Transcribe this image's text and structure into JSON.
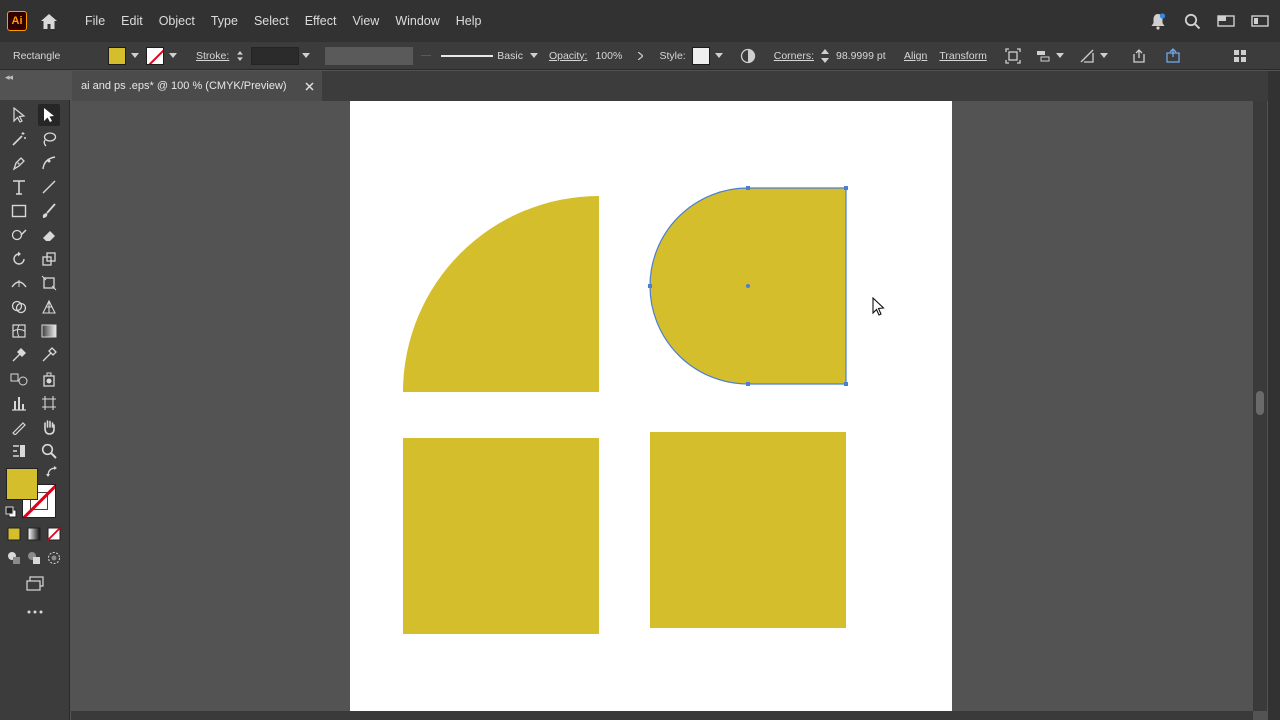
{
  "menubar": {
    "app_logo": "Ai",
    "items": [
      "File",
      "Edit",
      "Object",
      "Type",
      "Select",
      "Effect",
      "View",
      "Window",
      "Help"
    ]
  },
  "controlbar": {
    "selection_type": "Rectangle",
    "stroke_label": "Stroke:",
    "brush_label": "Basic",
    "opacity_label": "Opacity:",
    "opacity_value": "100%",
    "style_label": "Style:",
    "corners_label": "Corners:",
    "corners_value": "98.9999 pt",
    "align_label": "Align",
    "transform_label": "Transform"
  },
  "document": {
    "tab_title": "ai and ps .eps* @ 100 % (CMYK/Preview)"
  },
  "colors": {
    "fill": "#d4be2c",
    "selection": "#4a7fd6",
    "artboard": "#ffffff"
  },
  "icons": {
    "home": "home-icon",
    "notifications": "bell-icon",
    "search": "search-icon"
  }
}
